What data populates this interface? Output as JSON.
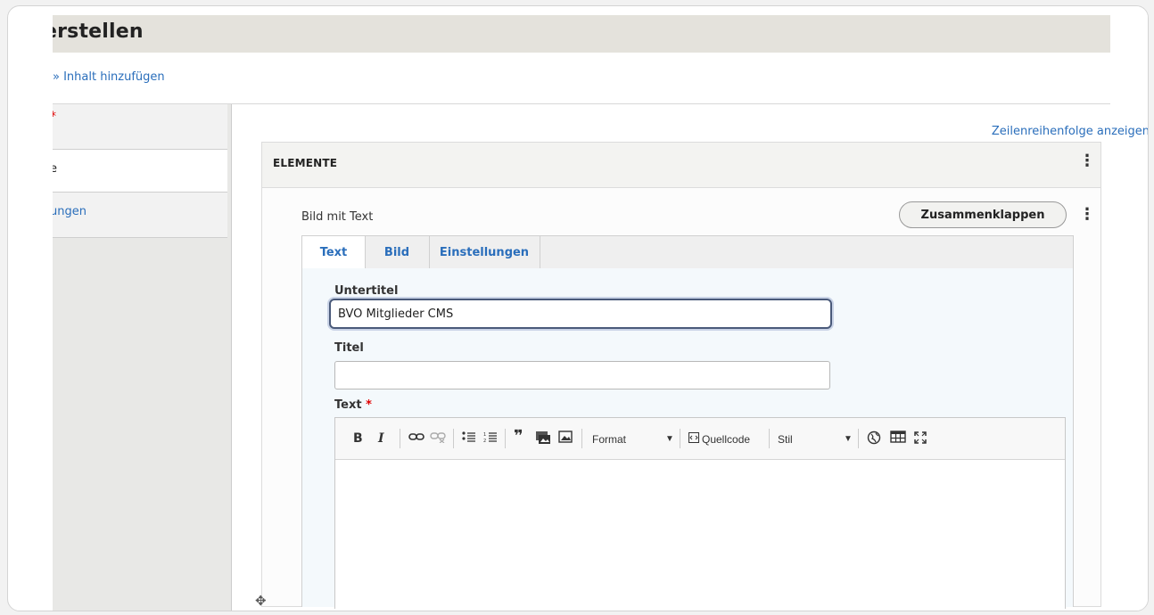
{
  "page": {
    "title": "erstellen"
  },
  "breadcrumb": "» Inhalt hinzufügen",
  "sidebar": {
    "items": [
      {
        "label": "",
        "required_mark": "*"
      },
      {
        "label": "e"
      },
      {
        "label": "ungen"
      }
    ]
  },
  "elements": {
    "row_order_link": "Zeilenreihenfolge anzeigen",
    "header": "ELEMENTE",
    "paragraph": {
      "type_label": "Bild mit Text",
      "collapse_button": "Zusammenklappen",
      "tabs": [
        {
          "label": "Text",
          "active": true
        },
        {
          "label": "Bild",
          "active": false
        },
        {
          "label": "Einstellungen",
          "active": false
        }
      ],
      "fields": {
        "subtitle": {
          "label": "Untertitel",
          "value": "BVÖ Mitglieder CMS"
        },
        "title": {
          "label": "Titel",
          "value": ""
        },
        "text": {
          "label": "Text",
          "required_mark": "*"
        }
      },
      "editor_toolbar": {
        "bold": "B",
        "italic": "I",
        "format_label": "Format",
        "source_label": "Quellcode",
        "style_label": "Stil",
        "icons": [
          "link-icon",
          "unlink-icon",
          "bulleted-list-icon",
          "numbered-list-icon",
          "blockquote-icon",
          "media-icon",
          "image-icon",
          "source-icon",
          "globe-icon",
          "table-icon",
          "maximize-icon"
        ]
      }
    }
  },
  "colors": {
    "link": "#2a6ebb",
    "required": "#e00000",
    "header_bar": "#e4e2dc",
    "focus_border": "#4a5a7a"
  }
}
